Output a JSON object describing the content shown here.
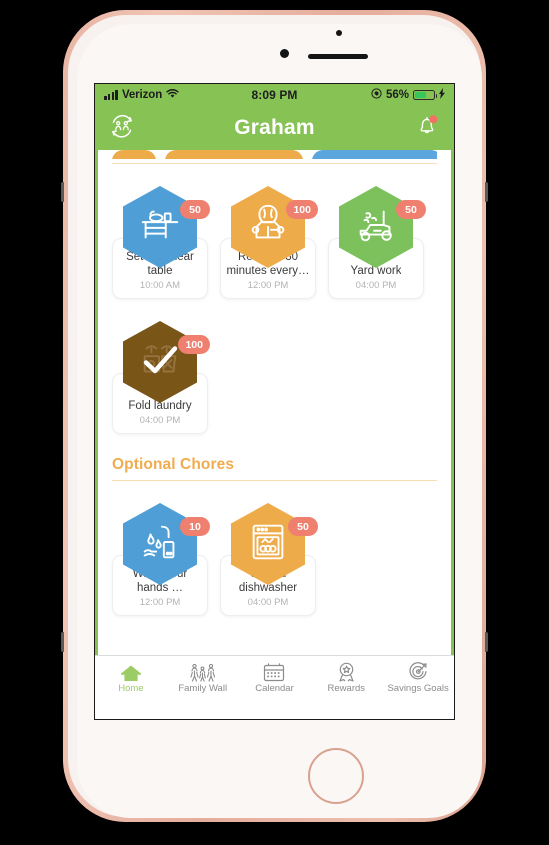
{
  "device": {
    "name": "iphone-rose-gold"
  },
  "status_bar": {
    "carrier": "Verizon",
    "wifi_icon": "wifi-icon",
    "signal_icon": "signal-bars-icon",
    "time": "8:09 PM",
    "rotation_lock_icon": "rotation-lock-icon",
    "battery_percent": "56%",
    "battery_level": 56,
    "charging_icon": "lightning-bolt-icon",
    "background_color": "#86c254"
  },
  "header": {
    "title": "Graham",
    "left_icon": "switch-user-icon",
    "right_icon": "bell-icon",
    "has_notification_dot": true,
    "background_color": "#86c254",
    "title_color": "#ffffff"
  },
  "scroll_top_pills": [
    {
      "name": "pill-partial-a",
      "color": "#eeab4a"
    },
    {
      "name": "pill-partial-b",
      "color": "#eeab4a"
    },
    {
      "name": "pill-partial-c",
      "color": "#5ba7dd"
    }
  ],
  "required_chores": {
    "divider_color": "#f6dfb6",
    "items": [
      {
        "title": "Set and clear table",
        "time": "10:00 AM",
        "points": "50",
        "hex_color": "#4f9fd6",
        "icon": "table-setting-icon",
        "completed": false
      },
      {
        "title": "Read for 30 minutes every…",
        "time": "12:00 PM",
        "points": "100",
        "hex_color": "#eeab4a",
        "icon": "child-reading-book-icon",
        "completed": false
      },
      {
        "title": "Yard work",
        "time": "04:00 PM",
        "points": "50",
        "hex_color": "#7cc15c",
        "icon": "lawn-mower-icon",
        "completed": false
      },
      {
        "title": "Fold laundry",
        "time": "04:00 PM",
        "points": "100",
        "hex_color": "#7a5518",
        "icon": "laundry-basket-icon",
        "completed": true
      }
    ]
  },
  "optional_chores": {
    "heading": "Optional Chores",
    "heading_color": "#f0ac4e",
    "divider_color": "#f7deb2",
    "items": [
      {
        "title": "Wash your hands …",
        "time": "12:00 PM",
        "points": "10",
        "hex_color": "#4f9fd6",
        "icon": "washing-hands-icon",
        "completed": false
      },
      {
        "title": "Unload dishwasher",
        "time": "04:00 PM",
        "points": "50",
        "hex_color": "#eeab4a",
        "icon": "dishwasher-icon",
        "completed": false
      }
    ]
  },
  "badge": {
    "background_color": "#ef7f6e",
    "text_color": "#ffffff"
  },
  "tab_bar": {
    "active_color": "#9ccc65",
    "inactive_color": "#8c8c8c",
    "tabs": [
      {
        "label": "Home",
        "icon": "home-icon",
        "active": true
      },
      {
        "label": "Family Wall",
        "icon": "family-icon",
        "active": false
      },
      {
        "label": "Calendar",
        "icon": "calendar-icon",
        "active": false
      },
      {
        "label": "Rewards",
        "icon": "award-ribbon-icon",
        "active": false
      },
      {
        "label": "Savings Goals",
        "icon": "target-icon",
        "active": false
      }
    ]
  }
}
